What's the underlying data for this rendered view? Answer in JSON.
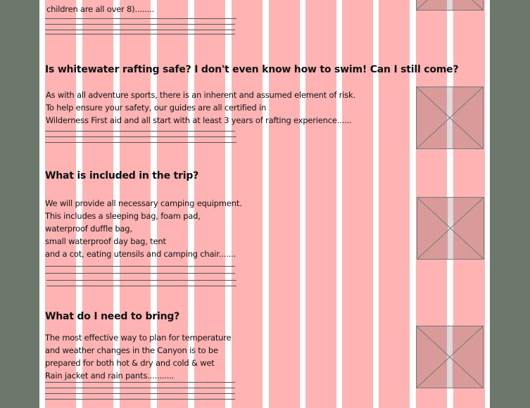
{
  "colors": {
    "backdrop": "#6c776c",
    "page": "#ffffff",
    "grid_column": "#ffb3b3",
    "placeholder": "#d99a9a"
  },
  "faq": [
    {
      "question": "",
      "answer_lines": [
        "children are all over 8)........"
      ]
    },
    {
      "question": "Is whitewater rafting safe? I don't even know how to swim! Can I still come?",
      "answer_lines": [
        "As with all adventure sports, there is an inherent and assumed element of risk.",
        "To help ensure your safety, our guides are all certified in",
        "Wilderness First aid and all start with at least 3 years of rafting experience......"
      ]
    },
    {
      "question": "What is included in the trip?",
      "answer_lines": [
        "We will provide all necessary camping equipment.",
        " This includes a sleeping bag, foam pad,",
        "waterproof duffle bag,",
        "small waterproof day bag, tent",
        "and a cot, eating utensils and camping chair......."
      ]
    },
    {
      "question": "What do I need to bring?",
      "answer_lines": [
        "The most effective way to plan for temperature",
        " and weather changes in the Canyon is to be",
        " prepared for both hot & dry and cold & wet",
        " Rain jacket and rain pants..........."
      ]
    }
  ],
  "image_placeholder_icon": "crossed-box-image-placeholder"
}
